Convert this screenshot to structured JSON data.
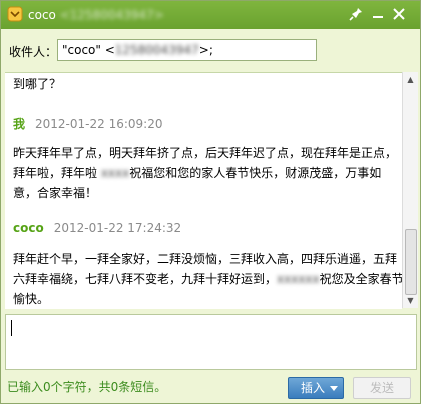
{
  "window": {
    "contact_name": "coco",
    "contact_number": "<12580043947>"
  },
  "recipient": {
    "label": "收件人：",
    "value_prefix": "\"coco\" <",
    "value_number": "12580043947",
    "value_suffix": ">;"
  },
  "history": {
    "previous_tail": "到哪了？",
    "messages": [
      {
        "sender": "我",
        "timestamp": "2012-01-22 16:09:20",
        "lines": [
          "昨天拜年早了点，明天拜年挤了点，后天拜年迟了点，现在拜年是正点，",
          "拜年啦，拜年啦 ",
          "意，合家幸福！"
        ],
        "line2_hidden": "xxxx",
        "line2_rest": "祝福您和您的家人春节快乐，财源茂盛，万事如"
      },
      {
        "sender": "coco",
        "timestamp": "2012-01-22 17:24:32",
        "lines": [
          "拜年赶个早，一拜全家好，二拜没烦恼，三拜收入高，四拜乐逍遥，五拜",
          "六拜幸福绕，七拜八拜不变老，九拜十拜好运到，",
          "愉快。"
        ],
        "line2_hidden": "xxxxxx",
        "line2_rest": "祝您及全家春节"
      }
    ]
  },
  "status": {
    "text": "已输入0个字符，共0条短信。"
  },
  "buttons": {
    "insert": "插入",
    "send": "发送"
  }
}
